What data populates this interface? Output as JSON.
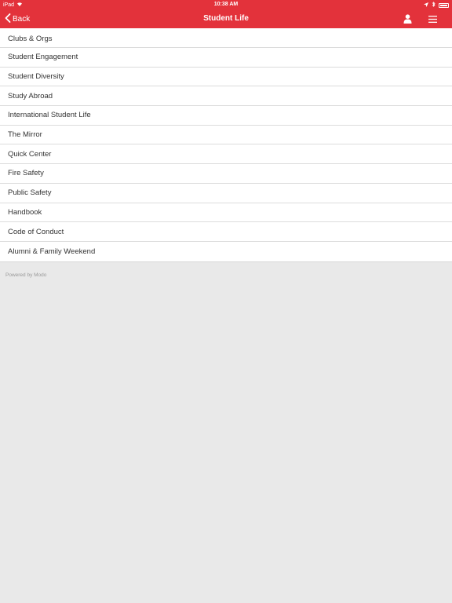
{
  "status_bar": {
    "device": "iPad",
    "time": "10:38 AM",
    "icons": [
      "wifi-icon",
      "location-icon",
      "bluetooth-icon",
      "battery-icon"
    ]
  },
  "navbar": {
    "back_label": "Back",
    "title": "Student Life",
    "icons": [
      "user-icon",
      "menu-icon"
    ]
  },
  "list": {
    "items": [
      "Clubs & Orgs",
      "Student Engagement",
      "Student Diversity",
      "Study Abroad",
      "International Student Life",
      "The Mirror",
      "Quick Center",
      "Fire Safety",
      "Public Safety",
      "Handbook",
      "Code of Conduct",
      "Alumni & Family Weekend"
    ]
  },
  "footer": {
    "powered_by": "Powered by Modo"
  },
  "colors": {
    "accent": "#e3323b",
    "background": "#e9e9e9",
    "list_bg": "#ffffff"
  }
}
